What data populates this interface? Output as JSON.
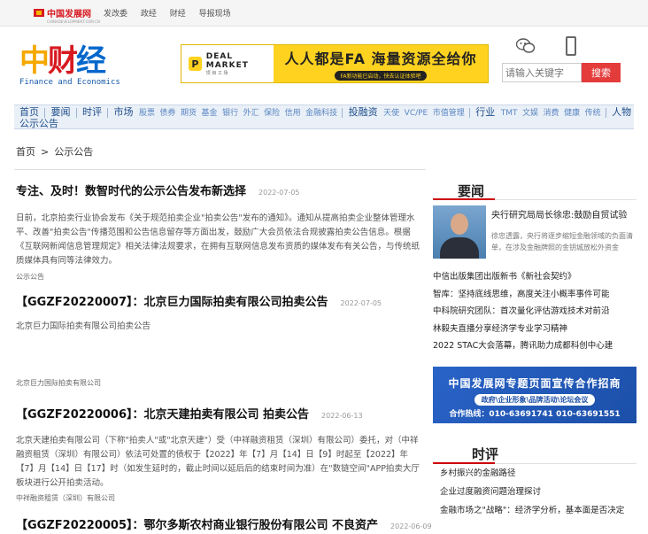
{
  "topbar": {
    "logo": "中国发展网",
    "logo_sub": "CHINADEVELOPMENT.COM.CN",
    "links": [
      "发改委",
      "政经",
      "财经",
      "导报现场"
    ]
  },
  "header": {
    "logo_c1": "中",
    "logo_c2": "财",
    "logo_c3": "经",
    "logo_en": "Finance and Economics",
    "banner": {
      "brand_mark": "P",
      "brand": "DEAL MARKET",
      "brand_sub": "项 目 工 场",
      "main": "人人都是FA  海量资源全给你",
      "sub": "FA新功能已启动，快去认证体验吧"
    },
    "search_placeholder": "请输入关键字",
    "search_button": "搜索"
  },
  "nav": {
    "line1": [
      {
        "main": "首页"
      },
      {
        "main": "要闻"
      },
      {
        "main": "时评"
      },
      {
        "main": "市场",
        "subs": [
          "股票",
          "债券",
          "期货",
          "基金",
          "银行",
          "外汇",
          "保险",
          "信用",
          "金融科技"
        ]
      },
      {
        "main": "投融资",
        "subs": [
          "天使",
          "VC/PE",
          "市值管理"
        ]
      },
      {
        "main": "行业",
        "subs": [
          "TMT",
          "文娱",
          "消费",
          "健康",
          "传统"
        ]
      },
      {
        "main": "人物"
      }
    ],
    "line2": "公示公告"
  },
  "breadcrumb": [
    "首页",
    ">",
    "公示公告"
  ],
  "articles": [
    {
      "title": "专注、及时！数智时代的公示公告发布新选择",
      "date": "2022-07-05",
      "body": "日前，北京拍卖行业协会发布《关于规范拍卖企业\"拍卖公告\"发布的通知》。通知从提高拍卖企业整体管理水平、改善\"拍卖公告\"传播范围和公告信息留存等方面出发，鼓励广大会员依法合规披露拍卖公告信息。根据《互联网新闻信息管理规定》相关法律法规要求，在拥有互联网信息发布资质的媒体发布有关公告，与传统纸质媒体具有同等法律效力。",
      "source": "公示公告"
    },
    {
      "title": "【GGZF20220007】：北京巨力国际拍卖有限公司拍卖公告",
      "date": "2022-07-05",
      "body": "北京巨力国际拍卖有限公司拍卖公告",
      "source": "北京巨力国际拍卖有限公司"
    },
    {
      "title": "【GGZF20220006】：北京天建拍卖有限公司 拍卖公告",
      "date": "2022-06-13",
      "body": "北京天建拍卖有限公司（下称\"拍卖人\"或\"北京天建\"）受（中祥融资租赁（深圳）有限公司）委托，对（中祥融资租赁（深圳）有限公司）依法可处置的债权于【2022】年【7】月【14】日【9】时起至【2022】年【7】月【14】日【17】时（如发生延时的，截止时间以延后后的结束时间为准）在\"数链空间\"APP拍卖大厅板块进行公开拍卖活动。",
      "source": "中祥融资租赁（深圳）有限公司"
    },
    {
      "title": "【GGZF20220005】：鄂尔多斯农村商业银行股份有限公司 不良资产",
      "date": "2022-06-09",
      "body": "",
      "source": ""
    }
  ],
  "sidebar": {
    "news_heading": "要闻",
    "featured_title": "央行研究局局长徐忠:鼓励自贸试验",
    "featured_desc": "徐忠透露，央行将逐步缩短金融领域的负面清单，在涉及金融牌照的金钥城放松外资金",
    "news_list": [
      "中信出版集团出版新书《新社会契约》",
      "智库：坚持底线思维，高度关注小概率事件可能",
      "中科院研究团队：首次量化评估游戏技术对前沿",
      "林毅夫直播分享经济学专业学习精神",
      "2022 STAC大会落幕，腾讯助力成都科创中心建"
    ],
    "ad": {
      "title": "中国发展网专题页面宣传合作招商",
      "sub": "政府\\企业形象\\品牌活动\\论坛会议",
      "contact": "合作热线：010-63691741  010-63691551"
    },
    "comment_heading": "时评",
    "comment_list": [
      "乡村振兴的金融路径",
      "企业过度融资问题治理探讨",
      "金融市场之\"战略\"：经济学分析，基本面是否决定"
    ]
  }
}
